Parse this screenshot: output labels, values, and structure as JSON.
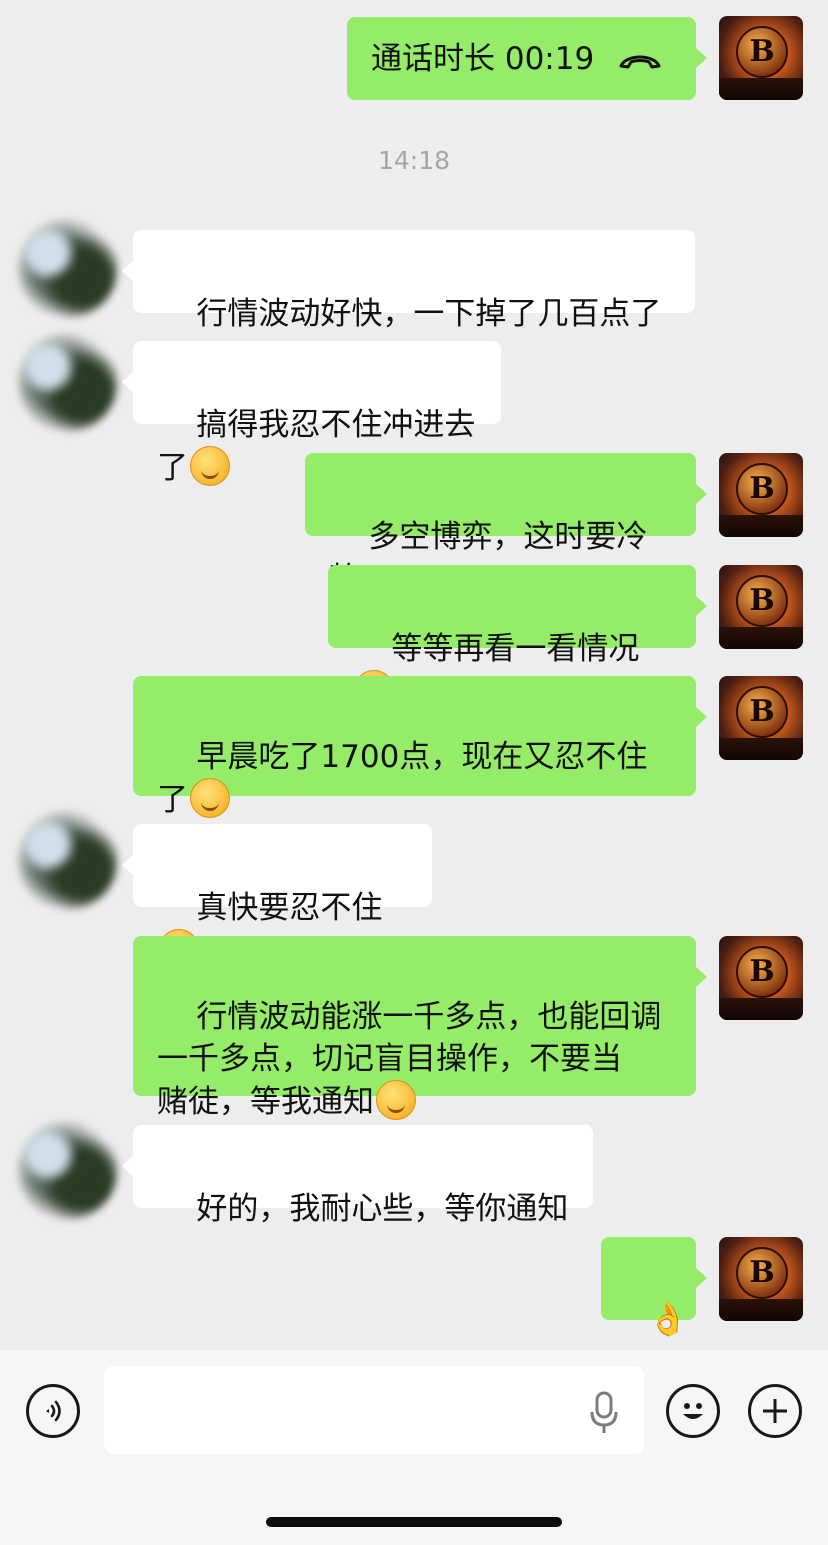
{
  "chat": {
    "call_message": {
      "label": "通话时长 00:19",
      "icon": "phone-hangup-icon"
    },
    "timestamp": "14:18",
    "messages": [
      {
        "side": "in",
        "text": "行情波动好快，一下掉了几百点了"
      },
      {
        "side": "in",
        "text": "搞得我忍不住冲进去了",
        "emoji": "facepalm-emoji"
      },
      {
        "side": "out",
        "text": "多空博弈，这时要冷静"
      },
      {
        "side": "out",
        "text": "等等再看一看情况",
        "emoji": "grin-emoji"
      },
      {
        "side": "out",
        "text": "早晨吃了1700点，现在又忍不住\n了",
        "emoji": "smirk-emoji"
      },
      {
        "side": "in",
        "text": "真快要忍不住",
        "emoji": "facepalm-emoji"
      },
      {
        "side": "out",
        "text": "行情波动能涨一千多点，也能回调\n一千多点，切记盲目操作，不要当\n赌徒，等我通知",
        "emoji": "thinking-emoji"
      },
      {
        "side": "in",
        "text": "好的，我耐心些，等你通知"
      },
      {
        "side": "out",
        "text": "👌"
      }
    ]
  },
  "input_bar": {
    "voice_icon": "voice-input-icon",
    "text_value": "",
    "mic_icon": "microphone-icon",
    "emoji_icon": "emoji-picker-icon",
    "plus_icon": "plus-icon"
  },
  "colors": {
    "background": "#ededed",
    "outgoing_bubble": "#95ec69",
    "incoming_bubble": "#ffffff",
    "timestamp": "#a5a5a5"
  },
  "avatars": {
    "me": "B"
  }
}
